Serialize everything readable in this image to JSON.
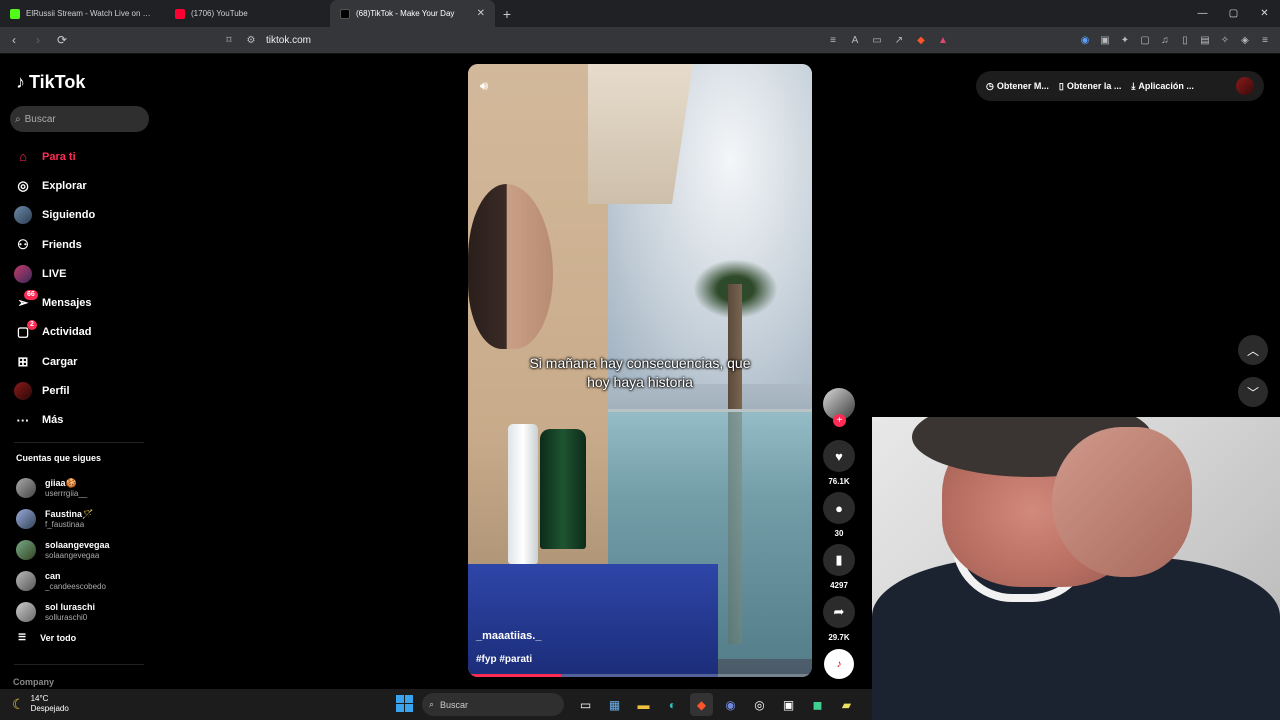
{
  "browser": {
    "tabs": [
      {
        "label": "ElRussii Stream - Watch Live on Kick",
        "color": "#53fc18"
      },
      {
        "label": "(1706) YouTube",
        "color": "#ff0033"
      },
      {
        "label": "(68)TikTok - Make Your Day",
        "color": "#ffffff"
      }
    ],
    "url": "tiktok.com"
  },
  "sidebar": {
    "logo": "TikTok",
    "search_placeholder": "Buscar",
    "nav": [
      {
        "label": "Para ti",
        "icon": "home-icon"
      },
      {
        "label": "Explorar",
        "icon": "compass-icon"
      },
      {
        "label": "Siguiendo",
        "icon": "following-icon"
      },
      {
        "label": "Friends",
        "icon": "friends-icon"
      },
      {
        "label": "LIVE",
        "icon": "live-icon"
      },
      {
        "label": "Mensajes",
        "icon": "messages-icon",
        "badge": "66"
      },
      {
        "label": "Actividad",
        "icon": "activity-icon",
        "badge": "2"
      },
      {
        "label": "Cargar",
        "icon": "upload-icon"
      },
      {
        "label": "Perfil",
        "icon": "profile-icon"
      },
      {
        "label": "Más",
        "icon": "more-icon"
      }
    ],
    "following_header": "Cuentas que sigues",
    "following": [
      {
        "name": "giiaa🍪",
        "user": "userrrgiia__"
      },
      {
        "name": "Faustina🪄",
        "user": "f_faustinaa"
      },
      {
        "name": "solaangevegaa",
        "user": "solaangevegaa"
      },
      {
        "name": "can",
        "user": "_candeescobedo"
      },
      {
        "name": "sol luraschi",
        "user": "solluraschi0"
      }
    ],
    "see_all": "Ver todo",
    "company": "Company"
  },
  "video": {
    "caption": "Si mañana hay consecuencias, que hoy haya historia",
    "author": "_maaatiias._",
    "tags": "#fyp #parati",
    "progress": 0.27
  },
  "actions": {
    "likes": "76.1K",
    "comments": "30",
    "saves": "4297",
    "shares": "29.7K"
  },
  "topbar": {
    "btn1": "Obtener M...",
    "btn2": "Obtener la ...",
    "btn3": "Aplicación ..."
  },
  "taskbar": {
    "temp": "14°C",
    "weather": "Despejado",
    "search": "Buscar"
  },
  "colors": {
    "accent": "#fe2c55",
    "background": "#000000"
  }
}
